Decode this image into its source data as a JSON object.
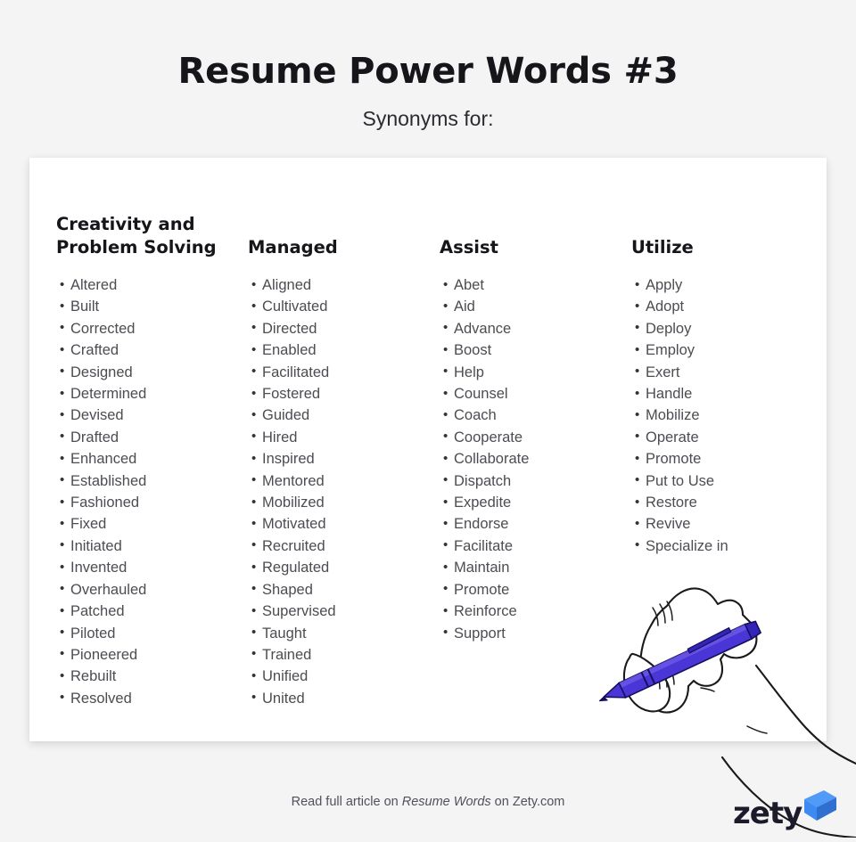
{
  "header": {
    "title": "Resume Power Words #3",
    "subtitle": "Synonyms for:"
  },
  "colors": {
    "background": "#f4f4f5",
    "card": "#ffffff",
    "heading_text": "#15151a",
    "body_text": "#4c4c52",
    "pen_blue": "#4a35d6",
    "logo_blue": "#3d8bf2",
    "logo_blue_dark": "#2f6fd0",
    "logo_text": "#1b1b2b"
  },
  "columns": [
    {
      "heading": "Creativity and\nProblem Solving",
      "words": [
        "Altered",
        "Built",
        "Corrected",
        "Crafted",
        "Designed",
        "Determined",
        "Devised",
        "Drafted",
        "Enhanced",
        "Established",
        "Fashioned",
        "Fixed",
        "Initiated",
        "Invented",
        "Overhauled",
        "Patched",
        "Piloted",
        "Pioneered",
        "Rebuilt",
        "Resolved"
      ]
    },
    {
      "heading": "Managed",
      "words": [
        "Aligned",
        "Cultivated",
        "Directed",
        "Enabled",
        "Facilitated",
        "Fostered",
        "Guided",
        "Hired",
        "Inspired",
        "Mentored",
        "Mobilized",
        "Motivated",
        "Recruited",
        "Regulated",
        "Shaped",
        "Supervised",
        "Taught",
        "Trained",
        "Unified",
        "United"
      ]
    },
    {
      "heading": "Assist",
      "words": [
        "Abet",
        "Aid",
        "Advance",
        "Boost",
        "Help",
        "Counsel",
        "Coach",
        "Cooperate",
        "Collaborate",
        "Dispatch",
        "Expedite",
        "Endorse",
        "Facilitate",
        "Maintain",
        "Promote",
        "Reinforce",
        "Support"
      ]
    },
    {
      "heading": "Utilize",
      "words": [
        "Apply",
        "Adopt",
        "Deploy",
        "Employ",
        "Exert",
        "Handle",
        "Mobilize",
        "Operate",
        "Promote",
        "Put to Use",
        "Restore",
        "Revive",
        "Specialize in"
      ]
    }
  ],
  "illustration": {
    "name": "hand-holding-pen-illustration"
  },
  "footer": {
    "text_before": "Read full article on ",
    "text_emphasis": "Resume Words",
    "text_after": " on Zety.com",
    "logo_word": "zety",
    "logo_mark": "zety-arrow-mark"
  }
}
